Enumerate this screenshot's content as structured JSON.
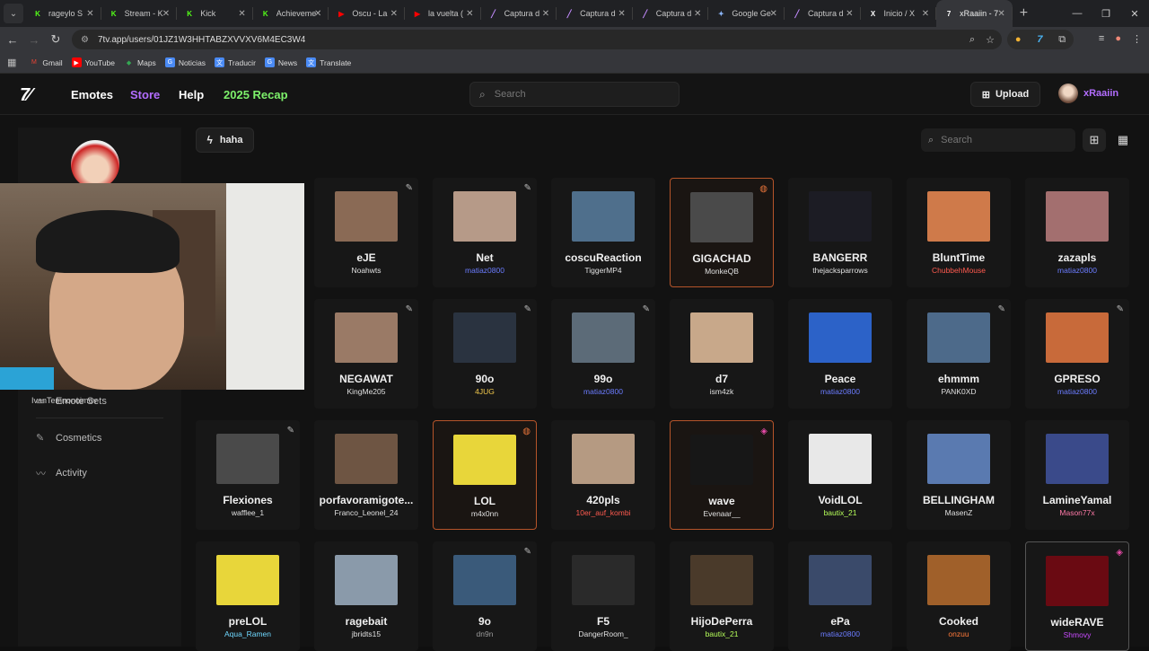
{
  "browser": {
    "tabs": [
      {
        "title": "rageylo S",
        "icon_color": "#53fc18",
        "glyph": "K"
      },
      {
        "title": "Stream - K",
        "icon_color": "#53fc18",
        "glyph": "K"
      },
      {
        "title": "Kick",
        "icon_color": "#53fc18",
        "glyph": "K"
      },
      {
        "title": "Achieveme",
        "icon_color": "#53fc18",
        "glyph": "K"
      },
      {
        "title": "Oscu - La",
        "icon_color": "#ff0000",
        "glyph": "▶"
      },
      {
        "title": "la vuelta (",
        "icon_color": "#ff0000",
        "glyph": "▶"
      },
      {
        "title": "Captura d",
        "icon_color": "#c48cff",
        "glyph": "╱"
      },
      {
        "title": "Captura d",
        "icon_color": "#c48cff",
        "glyph": "╱"
      },
      {
        "title": "Captura d",
        "icon_color": "#c48cff",
        "glyph": "╱"
      },
      {
        "title": "Google Ge",
        "icon_color": "#8ab4f8",
        "glyph": "✦"
      },
      {
        "title": "Captura d",
        "icon_color": "#c48cff",
        "glyph": "╱"
      },
      {
        "title": "Inicio / X",
        "icon_color": "#ffffff",
        "glyph": "X"
      },
      {
        "title": "xRaaiin - 7",
        "icon_color": "#ffffff",
        "glyph": "7"
      }
    ],
    "url": "7tv.app/users/01JZ1W3HHTABZXVVXV6M4EC3W4",
    "bookmarks": [
      "Gmail",
      "YouTube",
      "Maps",
      "Noticias",
      "Traducir",
      "News",
      "Translate"
    ]
  },
  "site": {
    "nav": {
      "emotes": "Emotes",
      "store": "Store",
      "help": "Help",
      "recap": "2025 Recap",
      "search_placeholder": "Search",
      "upload": "Upload",
      "username": "xRaaiin"
    },
    "sidebar": {
      "emote_sets": "Emote Sets",
      "cosmetics": "Cosmetics",
      "activity": "Activity",
      "partial_text": "IvanTemnonoimov"
    },
    "panel": {
      "tag": "haha",
      "search_placeholder": "Search"
    },
    "emotes": [
      {
        "name": "eJE",
        "owner": "Noahwts",
        "owner_color": "#e0e0e0",
        "thumb": "#8a6a55",
        "corner": "pencil"
      },
      {
        "name": "Net",
        "owner": "matiaz0800",
        "owner_color": "#6b7cff",
        "thumb": "#b69a88",
        "corner": "pencil"
      },
      {
        "name": "coscuReaction",
        "owner": "TiggerMP4",
        "owner_color": "#e0e0e0",
        "thumb": "#4f6f8c",
        "corner": ""
      },
      {
        "name": "GIGACHAD",
        "owner": "MonkeQB",
        "owner_color": "#e0e0e0",
        "thumb": "#4a4a4a",
        "corner": "fire",
        "highlight": "orange"
      },
      {
        "name": "BANGERR",
        "owner": "thejacksparrows",
        "owner_color": "#e0e0e0",
        "thumb": "#1c1c24",
        "corner": ""
      },
      {
        "name": "BluntTime",
        "owner": "ChubbehMouse",
        "owner_color": "#ff5a4f",
        "thumb": "#cf7a4a",
        "corner": ""
      },
      {
        "name": "zazapls",
        "owner": "matiaz0800",
        "owner_color": "#6b7cff",
        "thumb": "#a36f6f",
        "corner": ""
      },
      {
        "name": "NEGAWAT",
        "owner": "KingMe205",
        "owner_color": "#e0e0e0",
        "thumb": "#9a7a66",
        "corner": "pencil"
      },
      {
        "name": "90o",
        "owner": "4JUG",
        "owner_color": "#f2c94c",
        "thumb": "#2a3340",
        "corner": "pencil"
      },
      {
        "name": "99o",
        "owner": "matiaz0800",
        "owner_color": "#6b7cff",
        "thumb": "#5c6b78",
        "corner": "pencil"
      },
      {
        "name": "d7",
        "owner": "ism4zk",
        "owner_color": "#e0e0e0",
        "thumb": "#c8a88a",
        "corner": ""
      },
      {
        "name": "Peace",
        "owner": "matiaz0800",
        "owner_color": "#6b7cff",
        "thumb": "#2c62c8",
        "corner": ""
      },
      {
        "name": "ehmmm",
        "owner": "PANK0XD",
        "owner_color": "#e0e0e0",
        "thumb": "#4d6a8a",
        "corner": "pencil"
      },
      {
        "name": "GPRESO",
        "owner": "matiaz0800",
        "owner_color": "#6b7cff",
        "thumb": "#c86a3a",
        "corner": "pencil"
      },
      {
        "name": "Flexiones",
        "owner": "wafflee_1",
        "owner_color": "#e0e0e0",
        "thumb": "#4a4a4a",
        "corner": "pencil"
      },
      {
        "name": "porfavoramigote...",
        "owner": "Franco_Leonel_24",
        "owner_color": "#e0e0e0",
        "thumb": "#6e5543",
        "corner": ""
      },
      {
        "name": "LOL",
        "owner": "m4x0nn",
        "owner_color": "#e0e0e0",
        "thumb": "#e8d63a",
        "corner": "fire",
        "highlight": "orange"
      },
      {
        "name": "420pls",
        "owner": "10er_auf_kombi",
        "owner_color": "#ff5a4f",
        "thumb": "#b59a82",
        "corner": ""
      },
      {
        "name": "wave",
        "owner": "Evenaar__",
        "owner_color": "#e0e0e0",
        "thumb": "#171717",
        "corner": "stack",
        "highlight": "orange"
      },
      {
        "name": "VoidLOL",
        "owner": "bautix_21",
        "owner_color": "#b6ff5a",
        "thumb": "#e8e8e8",
        "corner": ""
      },
      {
        "name": "BELLINGHAM",
        "owner": "MasenZ",
        "owner_color": "#e0e0e0",
        "thumb": "#5a7ab0",
        "corner": ""
      },
      {
        "name": "LamineYamal",
        "owner": "Mason77x",
        "owner_color": "#ff7aa8",
        "thumb": "#3a4a8a",
        "corner": ""
      },
      {
        "name": "preLOL",
        "owner": "Aqua_Ramen",
        "owner_color": "#6fd8ff",
        "thumb": "#e8d63a",
        "corner": ""
      },
      {
        "name": "ragebait",
        "owner": "jbridts15",
        "owner_color": "#e0e0e0",
        "thumb": "#8a9aaa",
        "corner": ""
      },
      {
        "name": "9o",
        "owner": "dn9n",
        "owner_color": "#9a9a9a",
        "thumb": "#3a5a7a",
        "corner": "pencil"
      },
      {
        "name": "F5",
        "owner": "DangerRoom_",
        "owner_color": "#e0e0e0",
        "thumb": "#2a2a2a",
        "corner": ""
      },
      {
        "name": "HijoDePerra",
        "owner": "bautix_21",
        "owner_color": "#b6ff5a",
        "thumb": "#4a3a2a",
        "corner": ""
      },
      {
        "name": "ePa",
        "owner": "matiaz0800",
        "owner_color": "#6b7cff",
        "thumb": "#3a4a6a",
        "corner": ""
      },
      {
        "name": "Cooked",
        "owner": "onzuu",
        "owner_color": "#ff7a3a",
        "thumb": "#a0602a",
        "corner": ""
      },
      {
        "name": "wideRAVE",
        "owner": "Shmovy",
        "owner_color": "#c84aff",
        "thumb": "#6a0a12",
        "corner": "stack",
        "highlight": "gray"
      }
    ],
    "colors": {
      "store": "#b36dff",
      "recap": "#7df06b"
    }
  }
}
